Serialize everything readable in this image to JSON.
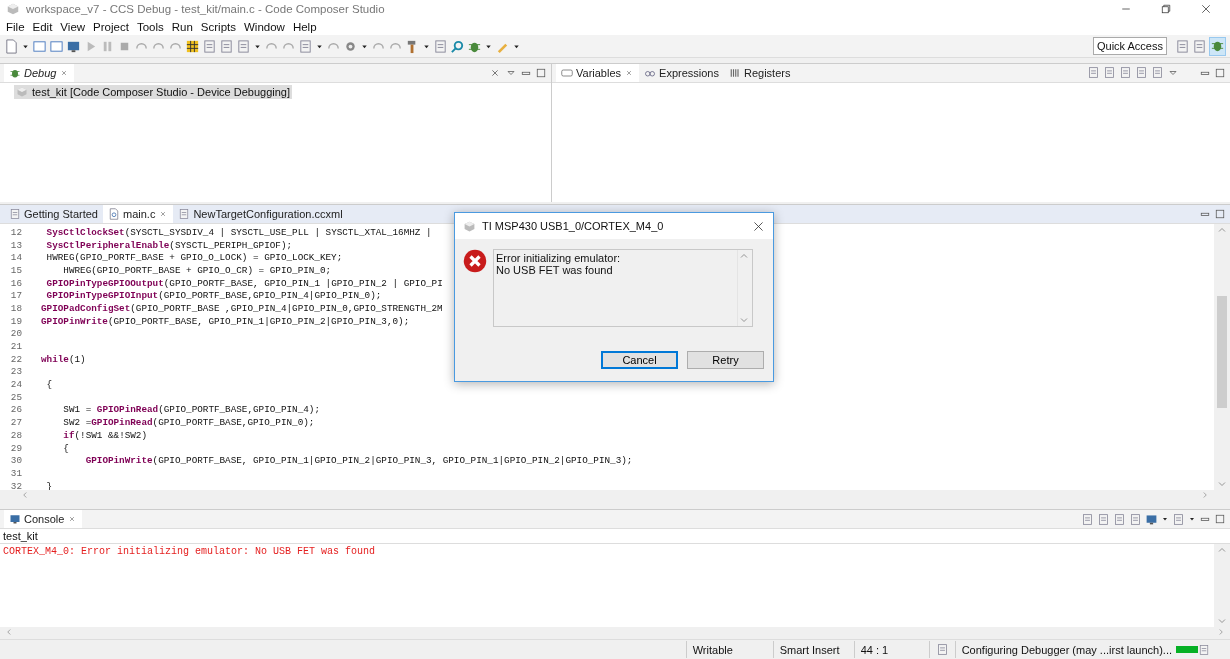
{
  "window": {
    "title": "workspace_v7 - CCS Debug - test_kit/main.c - Code Composer Studio"
  },
  "menu": [
    "File",
    "Edit",
    "View",
    "Project",
    "Tools",
    "Run",
    "Scripts",
    "Window",
    "Help"
  ],
  "quick_access": "Quick Access",
  "debug_view": {
    "tabs": [
      {
        "label": "Debug",
        "selected": true
      }
    ],
    "tree": [
      {
        "label": "test_kit [Code Composer Studio - Device Debugging]",
        "selected": true
      }
    ]
  },
  "variables_view": {
    "tabs": [
      {
        "label": "Variables",
        "selected": true
      },
      {
        "label": "Expressions",
        "selected": false
      },
      {
        "label": "Registers",
        "selected": false
      }
    ]
  },
  "editor": {
    "tabs": [
      {
        "label": "Getting Started",
        "selected": false
      },
      {
        "label": "main.c",
        "selected": true
      },
      {
        "label": "NewTargetConfiguration.ccxml",
        "selected": false
      }
    ],
    "lines": [
      {
        "number": "12",
        "text": " **SysCtlClockSet**(SYSCTL_SYSDIV_4 | SYSCTL_USE_PLL | SYSCTL_XTAL_16MHZ |"
      },
      {
        "number": "13",
        "text": " **SysCtlPeripheralEnable**(SYSCTL_PERIPH_GPIOF);"
      },
      {
        "number": "14",
        "text": " HWREG(GPIO_PORTF_BASE + GPIO_O_LOCK) = GPIO_LOCK_KEY;"
      },
      {
        "number": "15",
        "text": "    HWREG(GPIO_PORTF_BASE + GPIO_O_CR) = GPIO_PIN_0;"
      },
      {
        "number": "16",
        "text": " **GPIOPinTypeGPIOOutput**(GPIO_PORTF_BASE, GPIO_PIN_1 |GPIO_PIN_2 | GPIO_PI"
      },
      {
        "number": "17",
        "text": " **GPIOPinTypeGPIOInput**(GPIO_PORTF_BASE,GPIO_PIN_4|GPIO_PIN_0);"
      },
      {
        "number": "18",
        "text": "**GPIOPadConfigSet**(GPIO_PORTF_BASE ,GPIO_PIN_4|GPIO_PIN_0,GPIO_STRENGTH_2M"
      },
      {
        "number": "19",
        "text": "**GPIOPinWrite**(GPIO_PORTF_BASE, GPIO_PIN_1|GPIO_PIN_2|GPIO_PIN_3,0);"
      },
      {
        "number": "20"
      },
      {
        "number": "21"
      },
      {
        "number": "22",
        "text": "**while**(1)"
      },
      {
        "number": "23"
      },
      {
        "number": "24",
        "text": " {"
      },
      {
        "number": "25"
      },
      {
        "number": "26",
        "text": "    SW1 = **GPIOPinRead**(GPIO_PORTF_BASE,GPIO_PIN_4);"
      },
      {
        "number": "27",
        "text": "    SW2 =**GPIOPinRead**(GPIO_PORTF_BASE,GPIO_PIN_0);"
      },
      {
        "number": "28",
        "text": "    **if**(!SW1 &&!SW2)"
      },
      {
        "number": "29",
        "text": "    {"
      },
      {
        "number": "30",
        "text": "        **GPIOPinWrite**(GPIO_PORTF_BASE, GPIO_PIN_1|GPIO_PIN_2|GPIO_PIN_3, GPIO_PIN_1|GPIO_PIN_2|GPIO_PIN_3);"
      },
      {
        "number": "31"
      },
      {
        "number": "32",
        "text": " }"
      }
    ]
  },
  "dialog": {
    "title": "TI MSP430 USB1_0/CORTEX_M4_0",
    "message": [
      "Error initializing emulator:",
      "No USB FET was found"
    ],
    "buttons": [
      {
        "label": "Cancel",
        "default": true
      },
      {
        "label": "Retry",
        "default": false
      }
    ]
  },
  "console": {
    "tabs": [
      {
        "label": "Console",
        "selected": true
      }
    ],
    "name": "test_kit",
    "lines": [
      {
        "text": "CORTEX_M4_0: Error initializing emulator: No USB FET was found",
        "kind": "error"
      }
    ]
  },
  "status_bar": {
    "fields": [
      "Writable",
      "Smart Insert",
      "44 : 1"
    ],
    "progress": {
      "text": "Configuring Debugger (may ...irst launch)...",
      "level": 1
    }
  }
}
